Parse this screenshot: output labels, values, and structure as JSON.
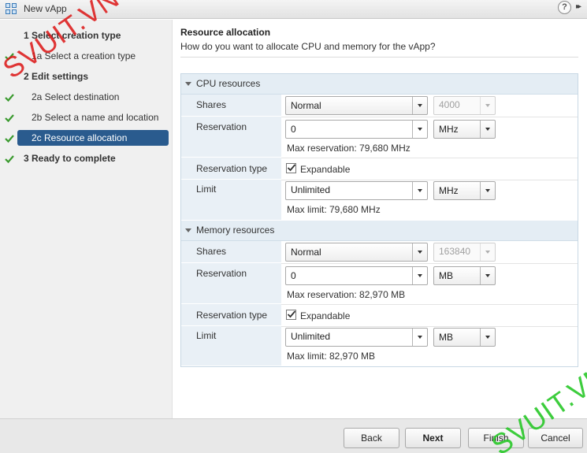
{
  "window": {
    "title": "New vApp",
    "help": "?",
    "expand": "▸▸"
  },
  "steps": [
    {
      "label": "1   Select creation type",
      "kind": "bold",
      "check": false
    },
    {
      "label": "1a  Select a creation type",
      "kind": "sub",
      "check": true
    },
    {
      "label": "2   Edit settings",
      "kind": "bold",
      "check": false
    },
    {
      "label": "2a  Select destination",
      "kind": "sub",
      "check": true
    },
    {
      "label": "2b  Select a name and location",
      "kind": "sub",
      "check": true
    },
    {
      "label": "2c  Resource allocation",
      "kind": "active",
      "check": true
    },
    {
      "label": "3   Ready to complete",
      "kind": "bold",
      "check": true
    }
  ],
  "page": {
    "title": "Resource allocation",
    "description": "How do you want to allocate CPU and memory for the vApp?"
  },
  "cpu": {
    "header": "CPU resources",
    "shares_label": "Shares",
    "shares_value": "Normal",
    "shares_number": "4000",
    "reservation_label": "Reservation",
    "reservation_value": "0",
    "reservation_unit": "MHz",
    "max_reservation": "Max reservation:    79,680 MHz",
    "reservation_type_label": "Reservation type",
    "expandable_label": "Expandable",
    "expandable_checked": true,
    "limit_label": "Limit",
    "limit_value": "Unlimited",
    "limit_unit": "MHz",
    "max_limit": "Max limit:    79,680 MHz"
  },
  "memory": {
    "header": "Memory resources",
    "shares_label": "Shares",
    "shares_value": "Normal",
    "shares_number": "163840",
    "reservation_label": "Reservation",
    "reservation_value": "0",
    "reservation_unit": "MB",
    "max_reservation": "Max reservation:    82,970 MB",
    "reservation_type_label": "Reservation type",
    "expandable_label": "Expandable",
    "expandable_checked": true,
    "limit_label": "Limit",
    "limit_value": "Unlimited",
    "limit_unit": "MB",
    "max_limit": "Max limit:    82,970 MB"
  },
  "footer": {
    "back": "Back",
    "next": "Next",
    "finish": "Finish",
    "cancel": "Cancel"
  },
  "watermarks": [
    "SVUIT.VN",
    "SVUIT.VN"
  ],
  "colors": {
    "accent": "#2a5b8e",
    "check": "#3a9a2e",
    "section_bg": "#e4edf4"
  }
}
